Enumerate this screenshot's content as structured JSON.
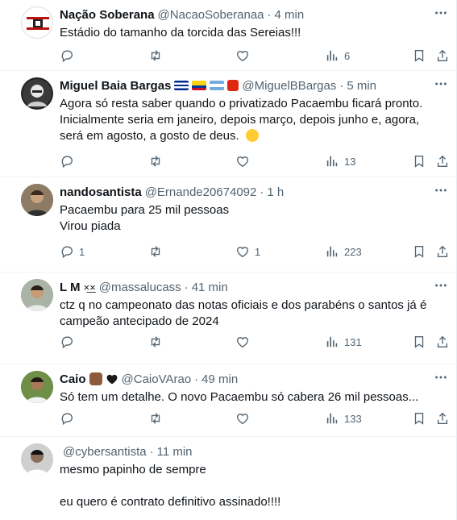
{
  "tweets": [
    {
      "name": "Nação Soberana",
      "handle": "@NacaoSoberanaa",
      "time": "4 min",
      "text": "Estádio do tamanho da torcida das Sereias!!!",
      "replies": "",
      "retweets": "",
      "likes": "",
      "views": "6"
    },
    {
      "name": "Miguel Baia Bargas",
      "handle": "@MiguelBBargas",
      "time": "5 min",
      "text": "Agora só resta saber quando o privatizado Pacaembu ficará pronto. Inicialmente seria em janeiro, depois março, depois junho e, agora, será em agosto, a gosto de deus.",
      "replies": "",
      "retweets": "",
      "likes": "",
      "views": "13"
    },
    {
      "name": "nandosantista",
      "handle": "@Ernande20674092",
      "time": "1 h",
      "text": "Pacaembu para 25 mil pessoas\nVirou piada",
      "replies": "1",
      "retweets": "",
      "likes": "1",
      "views": "223"
    },
    {
      "name": "L M",
      "handle": "@massalucass",
      "time": "41 min",
      "text": "ctz q no campeonato das notas oficiais e dos parabéns o santos já é campeão antecipado de 2024",
      "replies": "",
      "retweets": "",
      "likes": "",
      "views": "131"
    },
    {
      "name": "Caio",
      "handle": "@CaioVArao",
      "time": "49 min",
      "text": "Só tem um detalhe. O novo Pacaembu só cabera 26 mil pessoas...",
      "replies": "",
      "retweets": "",
      "likes": "",
      "views": "133"
    },
    {
      "name": "",
      "handle": "@cybersantista",
      "time": "11 min",
      "text": "mesmo papinho de sempre\n\neu quero é contrato definitivo assinado!!!!",
      "replies": "",
      "retweets": "",
      "likes": "",
      "views": ""
    }
  ],
  "colors": {
    "text": "#0f1419",
    "muted": "#536471",
    "divider": "#eff3f4"
  },
  "icons": [
    "more-icon",
    "reply-icon",
    "retweet-icon",
    "like-icon",
    "views-icon",
    "bookmark-icon",
    "share-icon"
  ]
}
